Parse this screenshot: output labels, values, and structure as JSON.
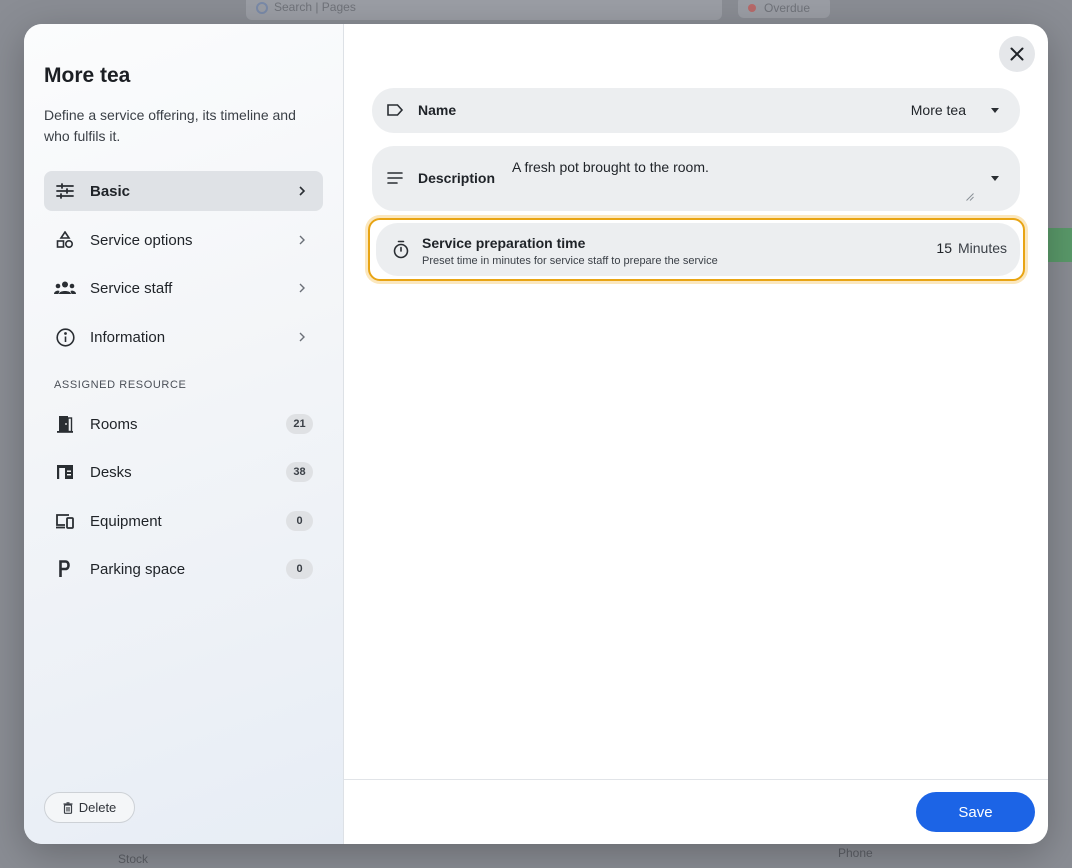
{
  "background": {
    "search_placeholder": "Search | Pages",
    "pill_label": "Overdue",
    "footer_left": "Stock",
    "footer_right": "Phone"
  },
  "sidebar": {
    "title": "More tea",
    "description": "Define a service offering, its timeline and who fulfils it.",
    "nav": [
      {
        "label": "Basic",
        "icon": "sliders-icon",
        "active": true
      },
      {
        "label": "Service options",
        "icon": "shapes-icon"
      },
      {
        "label": "Service staff",
        "icon": "people-icon"
      },
      {
        "label": "Information",
        "icon": "info-icon"
      }
    ],
    "section_label": "ASSIGNED RESOURCE",
    "resources": [
      {
        "label": "Rooms",
        "count": "21",
        "icon": "door-icon"
      },
      {
        "label": "Desks",
        "count": "38",
        "icon": "desk-icon"
      },
      {
        "label": "Equipment",
        "count": "0",
        "icon": "devices-icon"
      },
      {
        "label": "Parking space",
        "count": "0",
        "icon": "parking-icon"
      }
    ],
    "delete_label": "Delete"
  },
  "form": {
    "name": {
      "label": "Name",
      "value": "More tea"
    },
    "description": {
      "label": "Description",
      "value": "A fresh pot brought to the room."
    },
    "prep_time": {
      "label": "Service preparation time",
      "sublabel": "Preset time in minutes for service staff to prepare the service",
      "value": "15",
      "unit": "Minutes"
    }
  },
  "footer": {
    "save_label": "Save"
  },
  "colors": {
    "accent": "#1c64e6",
    "highlight": "#e8a413"
  }
}
